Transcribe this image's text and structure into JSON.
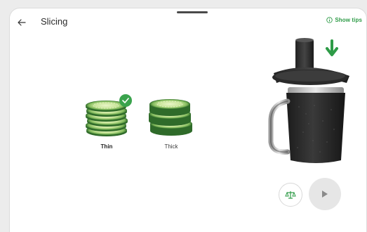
{
  "header": {
    "title": "Slicing",
    "tips_label": "Show tips",
    "back_icon": "arrow-left-icon",
    "tips_icon": "info-icon"
  },
  "options": [
    {
      "label": "Thin",
      "selected": true
    },
    {
      "label": "Thick",
      "selected": false
    }
  ],
  "actions": {
    "scale_icon": "scale-icon",
    "play_icon": "play-icon"
  },
  "colors": {
    "accent": "#3aa34d",
    "play_background": "#e6e6e6"
  }
}
